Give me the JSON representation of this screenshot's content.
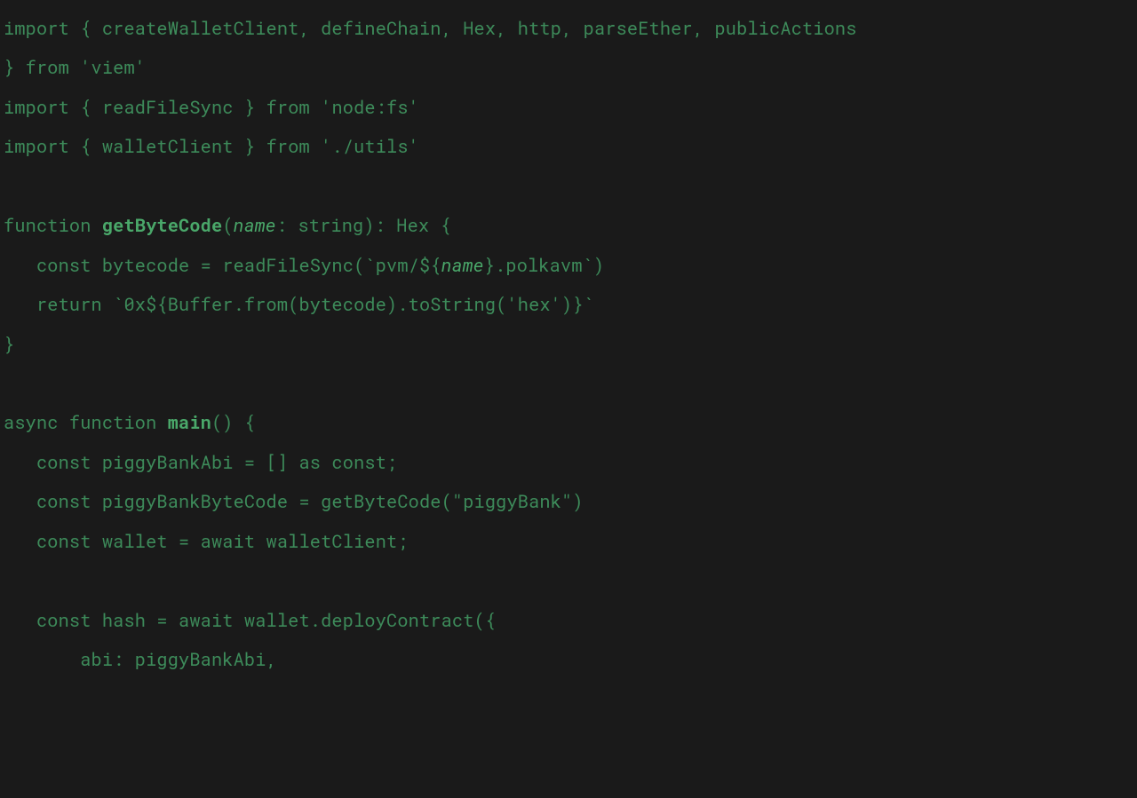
{
  "code": {
    "lines": [
      {
        "type": "line",
        "segments": [
          {
            "cls": "kw",
            "text": "import { createWalletClient, defineChain, Hex, http, parseEther, publicActions"
          }
        ]
      },
      {
        "type": "line",
        "segments": [
          {
            "cls": "kw",
            "text": "} "
          },
          {
            "cls": "kw",
            "text": "from"
          },
          {
            "cls": "kw",
            "text": " "
          },
          {
            "cls": "str",
            "text": "'viem'"
          }
        ]
      },
      {
        "type": "line",
        "segments": [
          {
            "cls": "kw",
            "text": "import { readFileSync } "
          },
          {
            "cls": "kw",
            "text": "from"
          },
          {
            "cls": "kw",
            "text": " "
          },
          {
            "cls": "str",
            "text": "'node:fs'"
          }
        ]
      },
      {
        "type": "line",
        "segments": [
          {
            "cls": "kw",
            "text": "import { walletClient } "
          },
          {
            "cls": "kw",
            "text": "from"
          },
          {
            "cls": "kw",
            "text": " "
          },
          {
            "cls": "str",
            "text": "'./utils'"
          }
        ]
      },
      {
        "type": "blank"
      },
      {
        "type": "line",
        "segments": [
          {
            "cls": "kw",
            "text": "function "
          },
          {
            "cls": "fn",
            "text": "getByteCode"
          },
          {
            "cls": "kw",
            "text": "("
          },
          {
            "cls": "param",
            "text": "name"
          },
          {
            "cls": "kw",
            "text": ": string): Hex {"
          }
        ]
      },
      {
        "type": "line",
        "segments": [
          {
            "cls": "kw",
            "text": "   const bytecode = readFileSync(`pvm/${"
          },
          {
            "cls": "param",
            "text": "name"
          },
          {
            "cls": "kw",
            "text": "}.polkavm`)"
          }
        ]
      },
      {
        "type": "line",
        "segments": [
          {
            "cls": "kw",
            "text": "   return `0x${Buffer.from(bytecode).toString('hex')}`"
          }
        ]
      },
      {
        "type": "line",
        "segments": [
          {
            "cls": "kw",
            "text": "}"
          }
        ]
      },
      {
        "type": "blank"
      },
      {
        "type": "line",
        "segments": [
          {
            "cls": "kw",
            "text": "async function "
          },
          {
            "cls": "fn",
            "text": "main"
          },
          {
            "cls": "kw",
            "text": "() {"
          }
        ]
      },
      {
        "type": "line",
        "segments": [
          {
            "cls": "kw",
            "text": "   const piggyBankAbi = [] as const;"
          }
        ]
      },
      {
        "type": "line",
        "segments": [
          {
            "cls": "kw",
            "text": "   const piggyBankByteCode = getByteCode(\"piggyBank\")"
          }
        ]
      },
      {
        "type": "line",
        "segments": [
          {
            "cls": "kw",
            "text": "   const wallet = await walletClient;"
          }
        ]
      },
      {
        "type": "blank"
      },
      {
        "type": "line",
        "segments": [
          {
            "cls": "kw",
            "text": "   const hash = await wallet.deployContract({"
          }
        ]
      },
      {
        "type": "line",
        "segments": [
          {
            "cls": "kw",
            "text": "       abi: piggyBankAbi,"
          }
        ]
      }
    ]
  }
}
